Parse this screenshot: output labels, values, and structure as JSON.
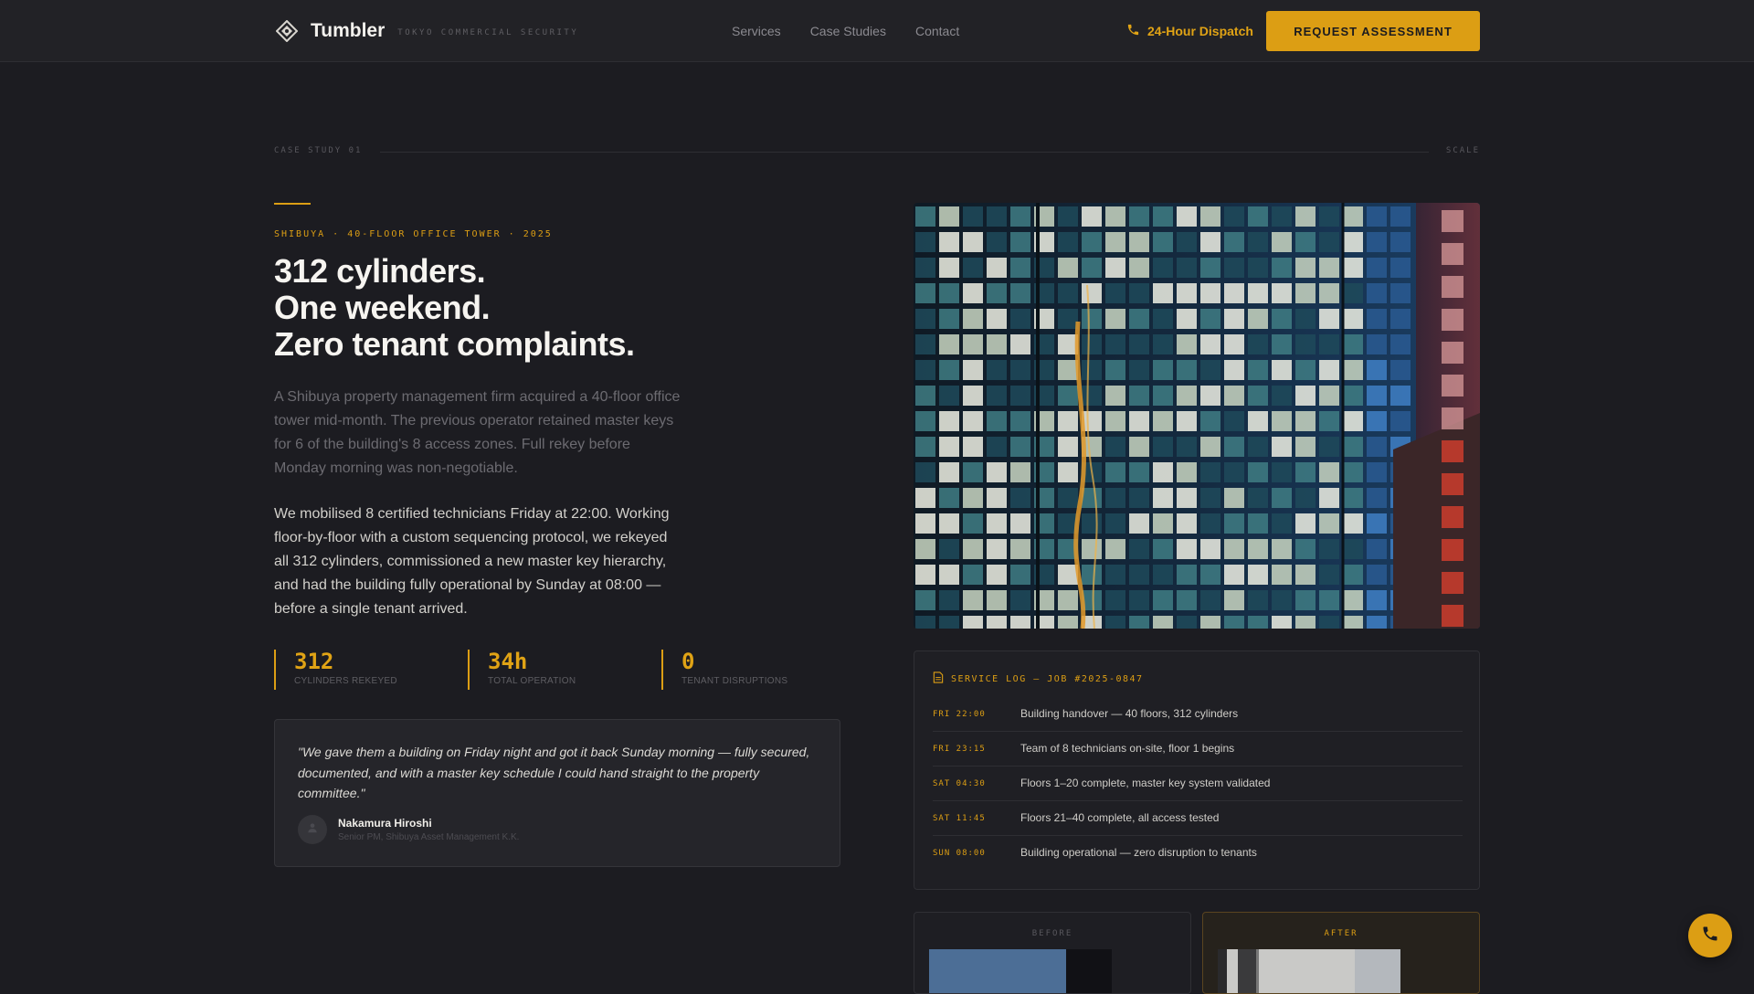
{
  "brand": {
    "name": "Tumbler",
    "tagline": "TOKYO COMMERCIAL SECURITY",
    "icon": "shield-diamond-icon"
  },
  "nav": {
    "links": [
      "Services",
      "Case Studies",
      "Contact"
    ],
    "dispatch_label": "24-Hour Dispatch",
    "cta_label": "REQUEST ASSESSMENT"
  },
  "colors": {
    "accent": "#dc9e14",
    "background": "#1c1c21",
    "nav_background": "#222226",
    "card_background": "#25252a"
  },
  "section": {
    "left_label": "CASE STUDY 01",
    "right_label": "SCALE"
  },
  "case": {
    "eyebrow": "SHIBUYA · 40-FLOOR OFFICE TOWER · 2025",
    "headline": [
      "312 cylinders.",
      "One weekend.",
      "Zero tenant complaints."
    ],
    "intro": "A Shibuya property management firm acquired a 40-floor office tower mid-month. The previous operator retained master keys for 6 of the building's 8 access zones. Full rekey before Monday morning was non-negotiable.",
    "body": "We mobilised 8 certified technicians Friday at 22:00. Working floor-by-floor with a custom sequencing protocol, we rekeyed all 312 cylinders, commissioned a new master key hierarchy, and had the building fully operational by Sunday at 08:00 — before a single tenant arrived."
  },
  "stats": [
    {
      "value": "312",
      "label": "CYLINDERS REKEYED"
    },
    {
      "value": "34h",
      "label": "TOTAL OPERATION"
    },
    {
      "value": "0",
      "label": "TENANT DISRUPTIONS"
    }
  ],
  "testimonial": {
    "quote": "\"We gave them a building on Friday night and got it back Sunday morning — fully secured, documented, and with a master key schedule I could hand straight to the property committee.\"",
    "name": "Nakamura Hiroshi",
    "role": "Senior PM, Shibuya Asset Management K.K.",
    "avatar_icon": "user-icon"
  },
  "service_log": {
    "title": "SERVICE LOG — JOB #2025-0847",
    "icon": "document-icon",
    "entries": [
      {
        "time": "FRI 22:00",
        "event": "Building handover — 40 floors, 312 cylinders"
      },
      {
        "time": "FRI 23:15",
        "event": "Team of 8 technicians on-site, floor 1 begins"
      },
      {
        "time": "SAT 04:30",
        "event": "Floors 1–20 complete, master key system validated"
      },
      {
        "time": "SAT 11:45",
        "event": "Floors 21–40 complete, all access tested"
      },
      {
        "time": "SUN 08:00",
        "event": "Building operational — zero disruption to tenants"
      }
    ]
  },
  "comparison": {
    "before_label": "BEFORE",
    "after_label": "AFTER"
  },
  "fab_icon": "phone-icon"
}
